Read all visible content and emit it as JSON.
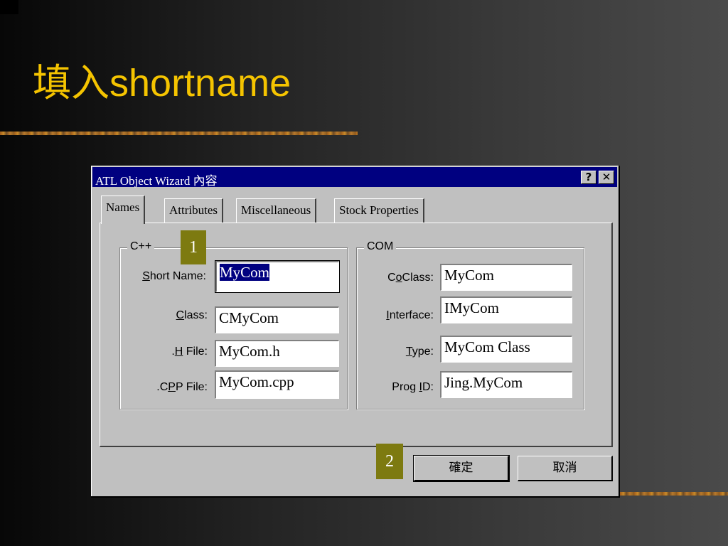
{
  "slide": {
    "title": "填入shortname"
  },
  "dialog": {
    "title": "ATL Object Wizard 內容",
    "help_label": "?",
    "close_label": "✕",
    "tabs": [
      {
        "label": "Names"
      },
      {
        "label": "Attributes"
      },
      {
        "label": "Miscellaneous"
      },
      {
        "label": "Stock Properties"
      }
    ],
    "cpp": {
      "legend": "C++",
      "short_name_label_pre": "",
      "short_name_label_u": "S",
      "short_name_label_post": "hort Name:",
      "short_name_value": "MyCom",
      "class_label_u": "C",
      "class_label_post": "lass:",
      "class_value": "CMyCom",
      "hfile_label_pre": ".",
      "hfile_label_u": "H",
      "hfile_label_post": " File:",
      "hfile_value": "MyCom.h",
      "cppfile_label_pre": ".C",
      "cppfile_label_u": "P",
      "cppfile_label_post": "P File:",
      "cppfile_value": "MyCom.cpp"
    },
    "com": {
      "legend": "COM",
      "coclass_label_pre": "C",
      "coclass_label_u": "o",
      "coclass_label_post": "Class:",
      "coclass_value": "MyCom",
      "interface_label_u": "I",
      "interface_label_post": "nterface:",
      "interface_value": "IMyCom",
      "type_label_u": "T",
      "type_label_post": "ype:",
      "type_value": "MyCom Class",
      "progid_label_pre": "Prog ",
      "progid_label_u": "I",
      "progid_label_post": "D:",
      "progid_value": "Jing.MyCom"
    },
    "ok_label": "確定",
    "cancel_label": "取消"
  },
  "annotations": {
    "step1": "1",
    "step2": "2"
  },
  "colors": {
    "title_color": "#f5c400",
    "titlebar": "#000080",
    "badge": "#7d7a10"
  }
}
